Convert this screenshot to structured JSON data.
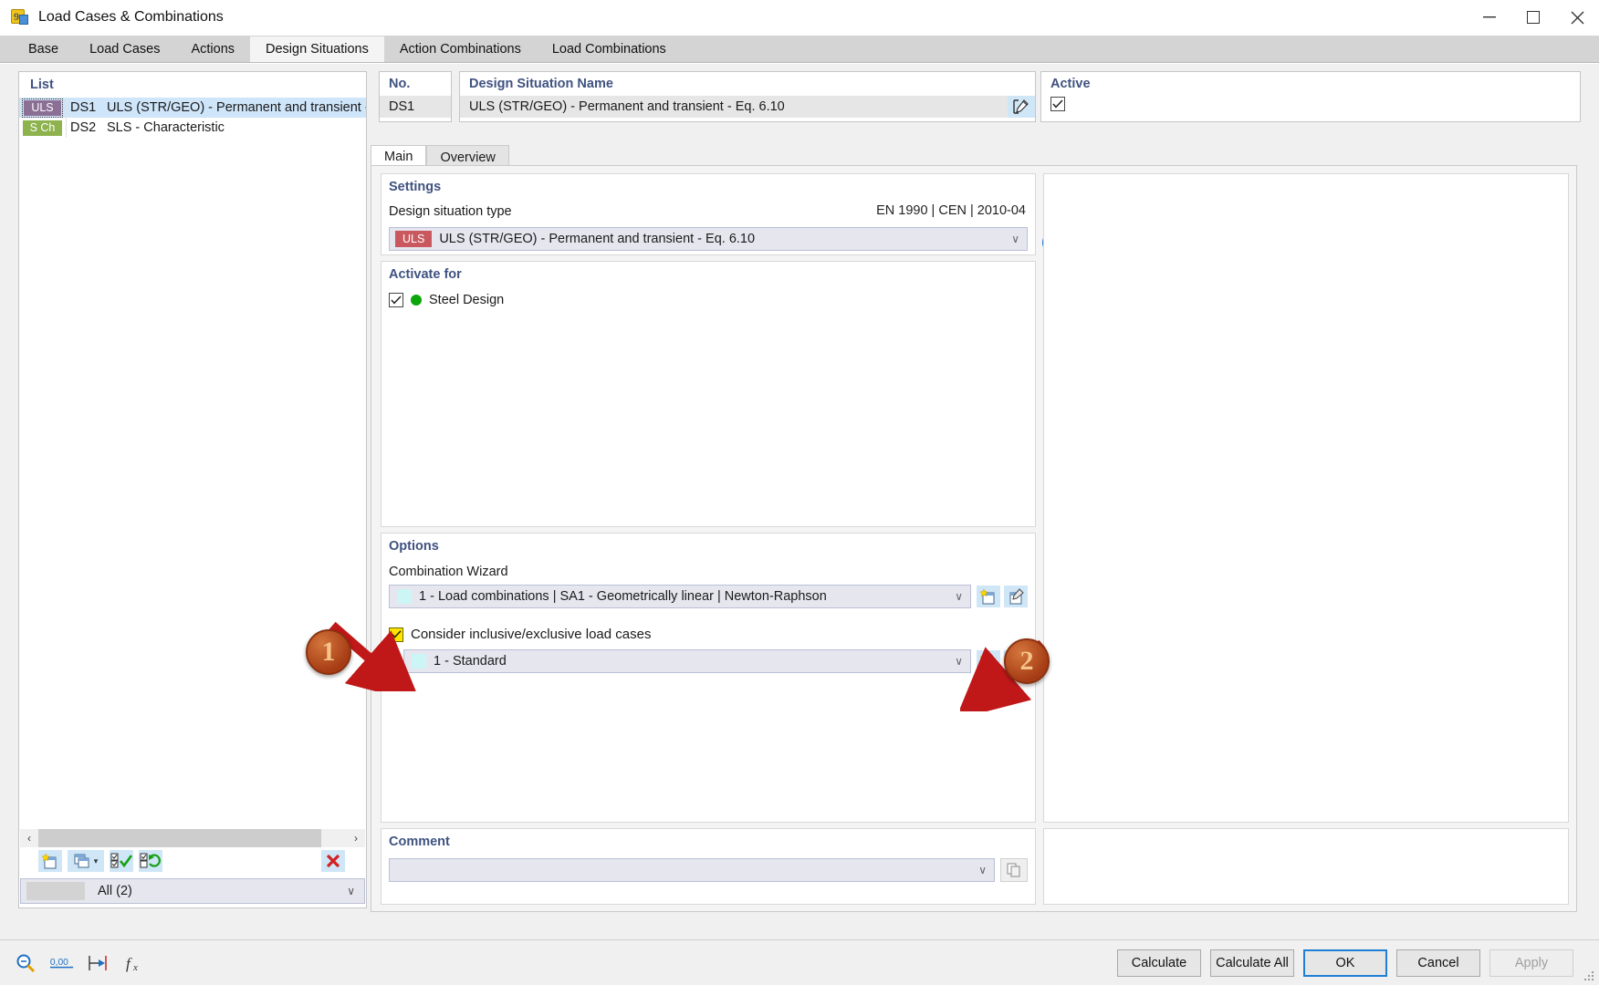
{
  "window": {
    "title": "Load Cases & Combinations",
    "icon": "app-icon",
    "minimize": "–",
    "maximize": "☐",
    "close": "✕"
  },
  "tabs": [
    {
      "label": "Base",
      "active": false
    },
    {
      "label": "Load Cases",
      "active": false
    },
    {
      "label": "Actions",
      "active": false
    },
    {
      "label": "Design Situations",
      "active": true
    },
    {
      "label": "Action Combinations",
      "active": false
    },
    {
      "label": "Load Combinations",
      "active": false
    }
  ],
  "list": {
    "title": "List",
    "rows": [
      {
        "tag": "ULS",
        "tag_type": "uls",
        "no": "DS1",
        "name": "ULS (STR/GEO) - Permanent and transient - Eq.",
        "selected": true
      },
      {
        "tag": "S Ch",
        "tag_type": "sch",
        "no": "DS2",
        "name": "SLS - Characteristic",
        "selected": false
      }
    ],
    "scroll_left": "‹",
    "scroll_right": "›",
    "toolbar": {
      "new_label": "new-item",
      "duplicate_label": "duplicate-item",
      "dropdown_caret": "▾",
      "select_all_label": "select-all",
      "invert_label": "invert-selection",
      "delete_label": "✕"
    },
    "filter": {
      "value": "All (2)",
      "caret": "∨"
    }
  },
  "no_field": {
    "label": "No.",
    "value": "DS1"
  },
  "name_field": {
    "label": "Design Situation Name",
    "value": "ULS (STR/GEO) - Permanent and transient - Eq. 6.10",
    "edit_button": "edit-name"
  },
  "active_field": {
    "label": "Active",
    "checked": true
  },
  "inner_tabs": [
    {
      "label": "Main",
      "active": true
    },
    {
      "label": "Overview",
      "active": false
    }
  ],
  "settings": {
    "title": "Settings",
    "type_label": "Design situation type",
    "standard": "EN 1990 | CEN | 2010-04",
    "type_pill": "ULS",
    "type_value": "ULS (STR/GEO) - Permanent and transient - Eq. 6.10",
    "caret": "∨",
    "info": "i"
  },
  "activate": {
    "title": "Activate for",
    "items": [
      {
        "label": "Steel Design",
        "checked": true,
        "color": "#0aa60a"
      }
    ]
  },
  "options": {
    "title": "Options",
    "wizard_label": "Combination Wizard",
    "wizard_value": "1 - Load combinations | SA1 - Geometrically linear | Newton-Raphson",
    "caret": "∨",
    "consider_label": "Consider inclusive/exclusive load cases",
    "consider_checked": true,
    "standard_value": "1 - Standard"
  },
  "comment": {
    "title": "Comment",
    "value": "",
    "caret": "∨"
  },
  "callouts": [
    {
      "number": "1"
    },
    {
      "number": "2"
    }
  ],
  "statusbar": {
    "icons": [
      "magnifier-icon",
      "decimal-places-icon",
      "units-icon",
      "function-icon"
    ]
  },
  "footer_buttons": [
    {
      "label": "Calculate",
      "style": "normal"
    },
    {
      "label": "Calculate All",
      "style": "normal"
    },
    {
      "label": "OK",
      "style": "primary"
    },
    {
      "label": "Cancel",
      "style": "normal"
    },
    {
      "label": "Apply",
      "style": "disabled"
    }
  ],
  "colors": {
    "accent_blue": "#1f7fd4",
    "header_blue": "#3f5280",
    "uls_pill": "#c9595f",
    "uls_tag": "#8b6f95",
    "sch_tag": "#8db24e",
    "green_dot": "#0aa60a",
    "callout": "#a63c15",
    "arrow_red": "#c01818"
  }
}
